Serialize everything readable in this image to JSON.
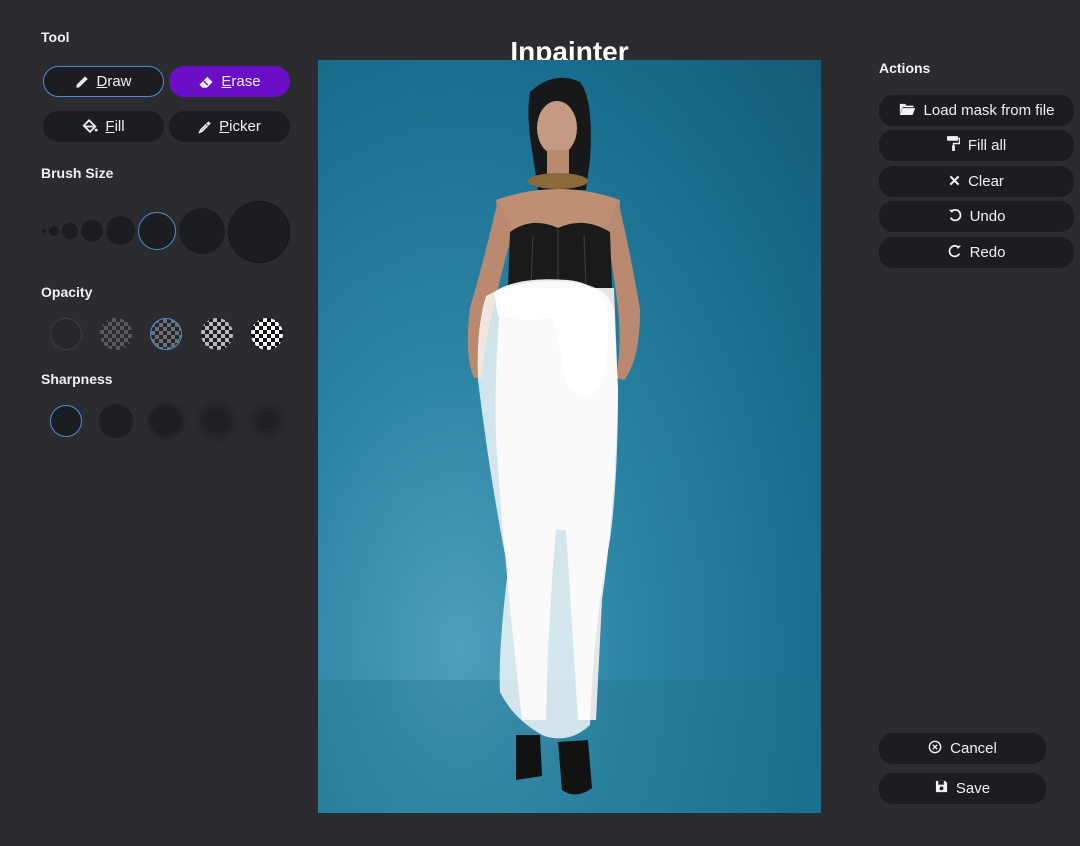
{
  "title": "Inpainter",
  "tool": {
    "label": "Tool",
    "draw": {
      "accel": "D",
      "rest": "raw"
    },
    "erase": {
      "accel": "E",
      "rest": "rase"
    },
    "fill": {
      "accel": "F",
      "rest": "ill"
    },
    "picker": {
      "accel": "P",
      "rest": "icker"
    },
    "selected": "draw",
    "accent_selected_color": "#4f8bd8",
    "erase_color": "#6a0fc7"
  },
  "brush_size": {
    "label": "Brush Size",
    "selected_index": 5
  },
  "opacity": {
    "label": "Opacity",
    "selected_index": 2
  },
  "sharpness": {
    "label": "Sharpness",
    "selected_index": 0
  },
  "actions": {
    "label": "Actions",
    "load_mask": "Load mask from file",
    "fill_all": "Fill all",
    "clear": "Clear",
    "undo": "Undo",
    "redo": "Redo"
  },
  "footer": {
    "cancel": "Cancel",
    "save": "Save"
  },
  "icons": [
    "pencil-icon",
    "eraser-icon",
    "paint-bucket-icon",
    "eyedropper-icon",
    "folder-open-icon",
    "paint-roller-icon",
    "close-icon",
    "undo-icon",
    "redo-icon",
    "cancel-circle-icon",
    "save-icon"
  ]
}
